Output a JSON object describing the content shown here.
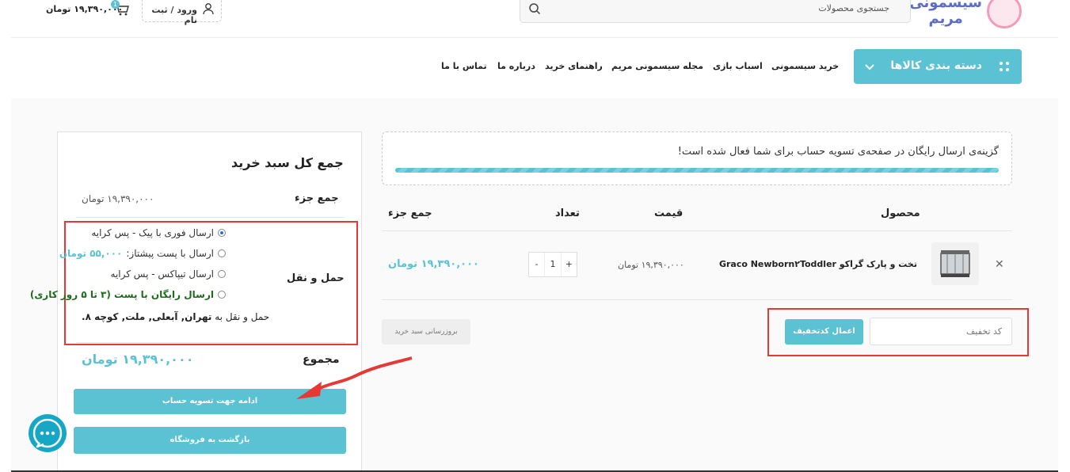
{
  "header": {
    "logo_text": "سیسمونی مریم",
    "search_placeholder": "جستجوی محصولات",
    "login_label": "ورود / ثبت نام",
    "cart_amount": "۱۹,۳۹۰,۰۰۰ تومان",
    "cart_count": "1"
  },
  "nav": {
    "category_button": "دسته بندی کالاها",
    "items": [
      "خرید سیسمونی",
      "اسباب بازی",
      "مجله سیسمونی مریم",
      "راهنمای خرید",
      "درباره ما",
      "تماس با ما"
    ]
  },
  "notice": {
    "text": "گزینه‌ی ارسال رایگان در صفحه‌ی تسویه حساب برای شما فعال شده است!",
    "progress": 1.0
  },
  "cart_table": {
    "headers": {
      "product": "محصول",
      "price": "قیمت",
      "quantity": "تعداد",
      "subtotal": "جمع جزء"
    },
    "rows": [
      {
        "name": "تخت و پارک گراکو Graco Newborn۲Toddler",
        "price": "۱۹,۳۹۰,۰۰۰ تومان",
        "quantity": "1",
        "subtotal": "۱۹,۳۹۰,۰۰۰ تومان"
      }
    ]
  },
  "coupon": {
    "placeholder": "کد تخفیف",
    "apply_label": "اعمال کدتخفیف",
    "update_label": "بروزرسانی سبد خرید"
  },
  "totals": {
    "title": "جمع کل سبد خرید",
    "subtotal_label": "جمع جزء",
    "subtotal_value": "۱۹,۳۹۰,۰۰۰ تومان",
    "shipping_label": "حمل و نقل",
    "shipping_options": [
      {
        "text": "ارسال فوری با پیک - پس کرایه",
        "price": "",
        "selected": true
      },
      {
        "text": "ارسال با پست پیشتاز:",
        "price": "۵۵,۰۰۰ تومان",
        "selected": false
      },
      {
        "text": "ارسال تیپاکس - پس کرایه",
        "price": "",
        "selected": false
      },
      {
        "text": "ارسال رایگان با پست (۳ تا ۵ روز کاری)",
        "price": "",
        "selected": false
      }
    ],
    "address_prefix": "حمل و نقل به",
    "address_value": "تهران, آبعلی, ملت, کوچه ۸.",
    "total_label": "مجموع",
    "total_value": "۱۹,۳۹۰,۰۰۰ تومان",
    "checkout_label": "ادامه جهت تسویه حساب",
    "back_label": "بازگشت به فروشگاه"
  },
  "colors": {
    "accent": "#5bc2d4",
    "highlight": "#e53935"
  }
}
